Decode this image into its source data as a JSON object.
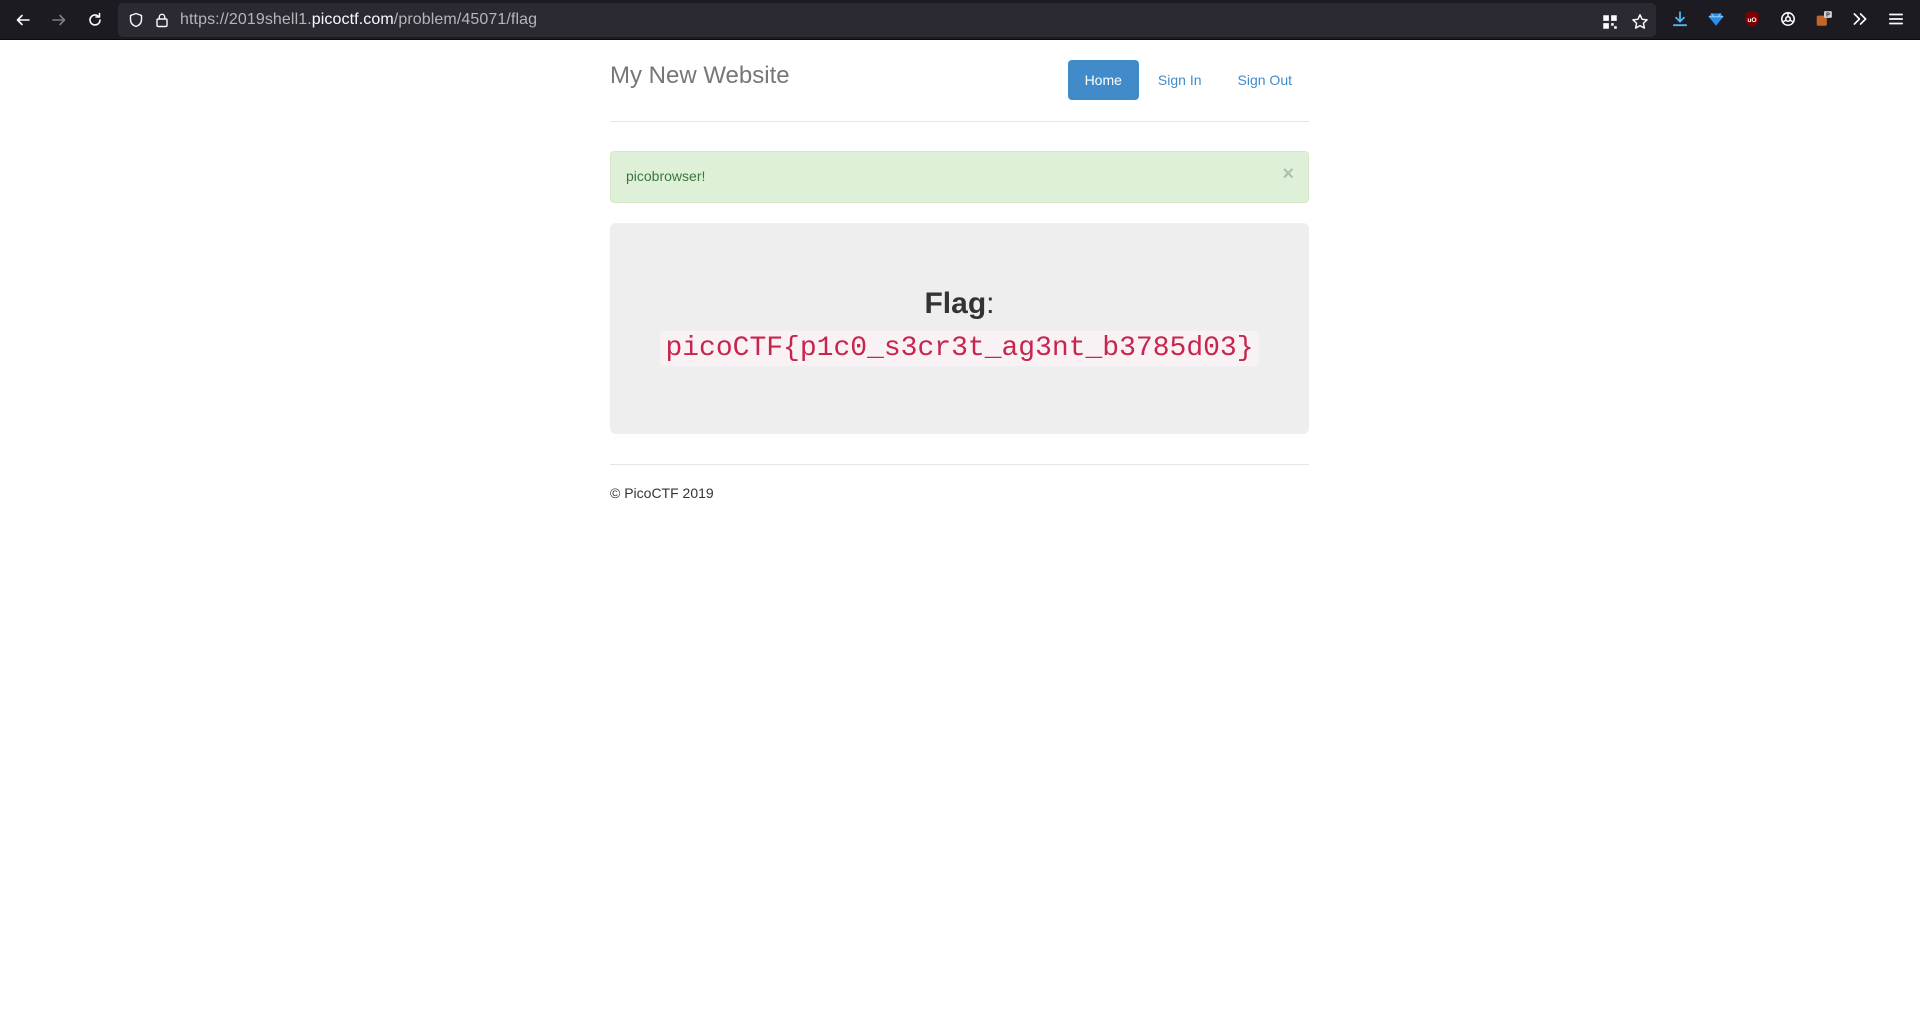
{
  "browser": {
    "url_prefix": "https://2019shell1.",
    "url_host": "picoctf.com",
    "url_path": "/problem/45071/flag",
    "colors": {
      "toolbar_bg": "#1c1b22",
      "urlbar_bg": "#2b2a33"
    },
    "icons": [
      "back-arrow-icon",
      "forward-arrow-icon",
      "reload-icon",
      "shield-icon",
      "lock-icon",
      "qr-grid-icon",
      "star-icon",
      "download-icon",
      "gem-extension-icon",
      "ublock-icon",
      "gear-extension-icon",
      "badge-extension-icon",
      "overflow-chevron-icon",
      "hamburger-menu-icon"
    ]
  },
  "site": {
    "brand": "My New Website",
    "nav": [
      {
        "label": "Home",
        "active": true
      },
      {
        "label": "Sign In",
        "active": false
      },
      {
        "label": "Sign Out",
        "active": false
      }
    ],
    "alert": {
      "message": "picobrowser!",
      "close": "×"
    },
    "flag": {
      "title": "Flag",
      "colon": ":",
      "value": "picoCTF{p1c0_s3cr3t_ag3nt_b3785d03}"
    },
    "footer": "© PicoCTF 2019",
    "colors": {
      "primary": "#428bca",
      "alert_bg": "#dff0d8",
      "alert_text": "#3c763d",
      "jumbotron_bg": "#eeeeee",
      "code_text": "#c7254e",
      "code_bg": "#f9f2f4"
    }
  }
}
